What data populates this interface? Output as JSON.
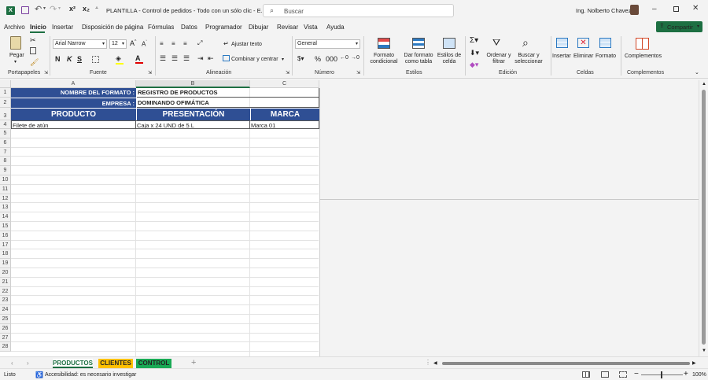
{
  "title_bar": {
    "autosave_icon": "save-icon",
    "title": "PLANTILLA - Control de pedidos - Todo con un sólo clic  -  E...",
    "search_placeholder": "Buscar",
    "user_name": "Ing. Nolberto Chavez"
  },
  "menu": {
    "items": [
      "Archivo",
      "Inicio",
      "Insertar",
      "Disposición de página",
      "Fórmulas",
      "Datos",
      "Programador",
      "Dibujar",
      "Revisar",
      "Vista",
      "Ayuda"
    ],
    "active": "Inicio",
    "share_label": "Compartir"
  },
  "ribbon": {
    "paste_label": "Pegar",
    "clipboard_group": "Portapapeles",
    "font_name": "Arial Narrow",
    "font_size": "12",
    "font_group": "Fuente",
    "wrap_text": "Ajustar texto",
    "merge_center": "Combinar y centrar",
    "alignment_group": "Alineación",
    "number_format": "General",
    "number_group": "Número",
    "cond_format": [
      "Formato",
      "condicional"
    ],
    "table_format": [
      "Dar formato",
      "como tabla"
    ],
    "cell_styles": [
      "Estilos de",
      "celda"
    ],
    "styles_group": "Estilos",
    "sort_filter": [
      "Ordenar y",
      "filtrar"
    ],
    "find_select": [
      "Buscar y",
      "seleccionar"
    ],
    "editing_group": "Edición",
    "insert": "Insertar",
    "delete": "Eliminar",
    "format": "Formato",
    "cells_group": "Celdas",
    "addins": "Complementos",
    "addins_group": "Complementos"
  },
  "sheet": {
    "columns": [
      "A",
      "B",
      "C"
    ],
    "rows": [
      "1",
      "2",
      "3",
      "4",
      "5",
      "6",
      "7",
      "8",
      "9",
      "10",
      "11",
      "12",
      "13",
      "14",
      "15",
      "16",
      "17",
      "18",
      "19",
      "20",
      "21",
      "22",
      "23",
      "24",
      "25",
      "26",
      "27",
      "28"
    ],
    "r1_label": "NOMBRE DEL FORMATO :",
    "r1_value": "REGISTRO DE PRODUCTOS",
    "r2_label": "EMPRESA :",
    "r2_value": "DOMINANDO OFIMÁTICA",
    "headers": [
      "PRODUCTO",
      "PRESENTACIÓN",
      "MARCA"
    ],
    "row4": [
      "Filete de atún",
      "Caja x 24 UND de 5 L",
      "Marca 01"
    ],
    "header_color": "#2f4f94"
  },
  "tabs": [
    {
      "label": "PRODUCTOS",
      "color": "#ffffff"
    },
    {
      "label": "CLIENTES",
      "color": "#ffc000"
    },
    {
      "label": "CONTROL",
      "color": "#1aaa55"
    }
  ],
  "status": {
    "ready": "Listo",
    "accessibility": "Accesibilidad: es necesario investigar",
    "zoom": "100%"
  }
}
